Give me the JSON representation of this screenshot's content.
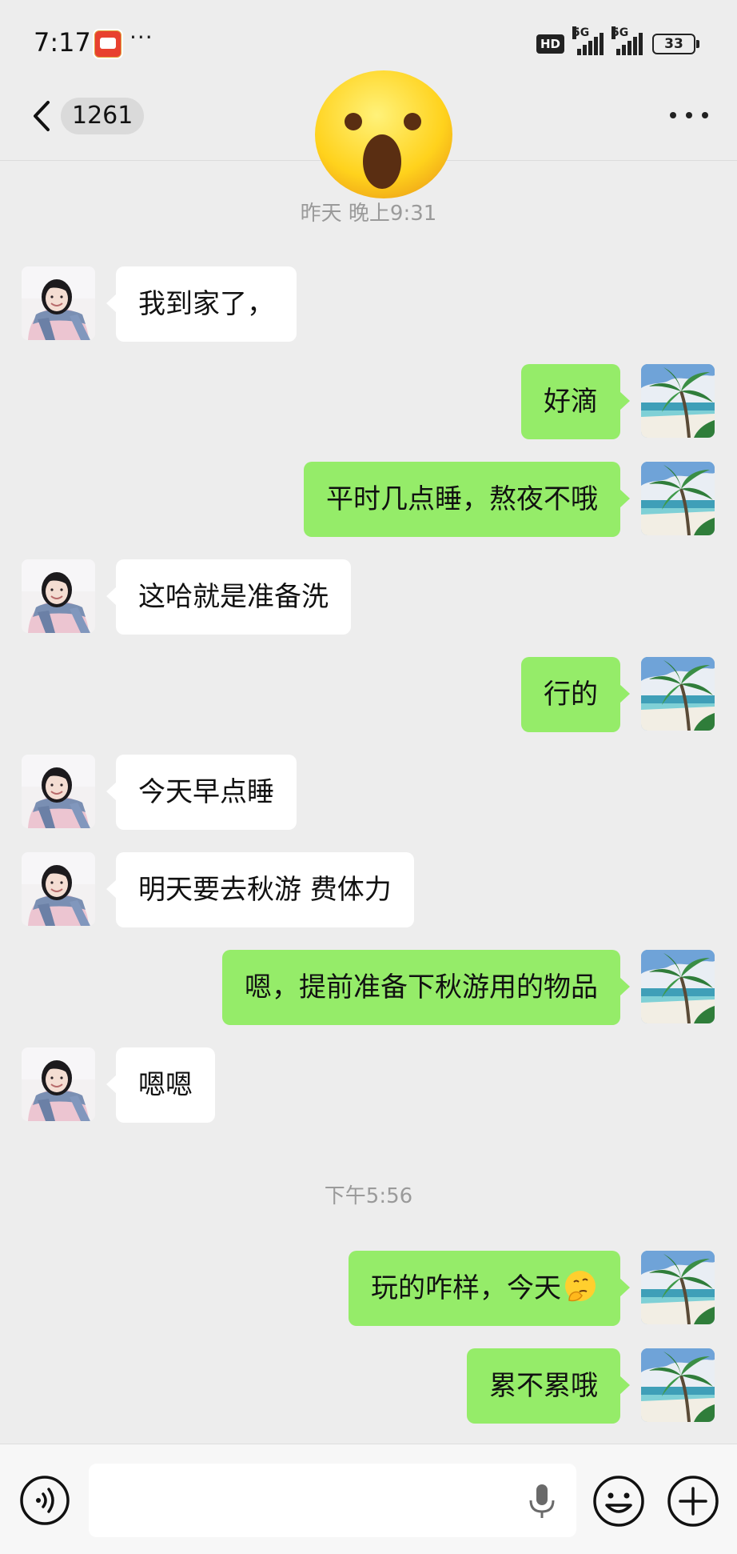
{
  "status_bar": {
    "time": "7:17",
    "dots": "···",
    "hd_label": "HD",
    "network_1": "5G",
    "network_2": "5G",
    "battery": "33"
  },
  "header": {
    "unread_count": "1261"
  },
  "timestamps": [
    "昨天 晚上9:31",
    "下午5:56"
  ],
  "messages": [
    {
      "side": "left",
      "text": "我到家了，"
    },
    {
      "side": "right",
      "text": "好滴"
    },
    {
      "side": "right",
      "text": "平时几点睡，熬夜不哦"
    },
    {
      "side": "left",
      "text": "这哈就是准备洗"
    },
    {
      "side": "right",
      "text": "行的"
    },
    {
      "side": "left",
      "text": "今天早点睡"
    },
    {
      "side": "left",
      "text": "明天要去秋游 费体力"
    },
    {
      "side": "right",
      "text": "嗯，提前准备下秋游用的物品"
    },
    {
      "side": "left",
      "text": "嗯嗯"
    },
    {
      "side": "right",
      "text": "玩的咋样，今天",
      "emoji": "thinking-face"
    },
    {
      "side": "right",
      "text": "累不累哦"
    }
  ],
  "icons": {
    "overlay": "astonished-face-emoji",
    "left_avatar": "girl-with-scarf-avatar",
    "right_avatar": "palm-beach-avatar",
    "input_left": "voice-toggle-icon",
    "input_mic": "microphone-icon",
    "input_emoji": "smile-icon",
    "input_plus": "plus-icon"
  },
  "input": {
    "value": ""
  },
  "colors": {
    "background": "#ededed",
    "sent_bubble": "#95ec69",
    "received_bubble": "#ffffff",
    "timestamp": "#9a9a9a"
  }
}
